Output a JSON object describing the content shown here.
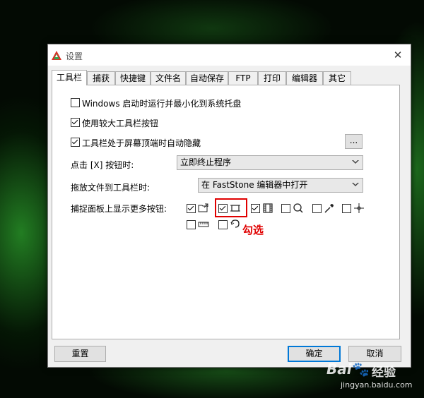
{
  "window": {
    "title": "设置",
    "close_glyph": "✕"
  },
  "tabs": [
    "工具栏",
    "捕获",
    "快捷键",
    "文件名",
    "自动保存",
    "FTP",
    "打印",
    "编辑器",
    "其它"
  ],
  "active_tab": 0,
  "toolbar": {
    "opt_startup": {
      "label": "Windows 启动时运行并最小化到系统托盘",
      "checked": false
    },
    "opt_large_buttons": {
      "label": "使用较大工具栏按钮",
      "checked": true
    },
    "opt_autohide": {
      "label": "工具栏处于屏幕顶端时自动隐藏",
      "checked": true
    },
    "autohide_more_label": "...",
    "close_click_label": "点击 [X] 按钮时:",
    "close_click_value": "立即终止程序",
    "drag_file_label": "拖放文件到工具栏时:",
    "drag_file_value": "在 FastStone 编辑器中打开",
    "more_buttons_label": "捕捉面板上显示更多按钮:",
    "more_buttons": [
      {
        "icon": "open-folder-icon",
        "checked": true
      },
      {
        "icon": "fixed-region-icon",
        "checked": true
      },
      {
        "icon": "video-record-icon",
        "checked": true
      },
      {
        "icon": "magnifier-icon",
        "checked": false
      },
      {
        "icon": "color-picker-icon",
        "checked": false
      },
      {
        "icon": "crosshair-icon",
        "checked": false
      },
      {
        "icon": "ruler-icon",
        "checked": false
      },
      {
        "icon": "scroll-capture-icon",
        "checked": false
      }
    ]
  },
  "annotation": "勾选",
  "buttons": {
    "reset": "重置",
    "ok": "确定",
    "cancel": "取消"
  },
  "watermark": {
    "brand": "Bai",
    "brand_tail": "经验",
    "url": "jingyan.baidu.com"
  },
  "colors": {
    "highlight": "#e00000",
    "accent": "#0078d7"
  }
}
